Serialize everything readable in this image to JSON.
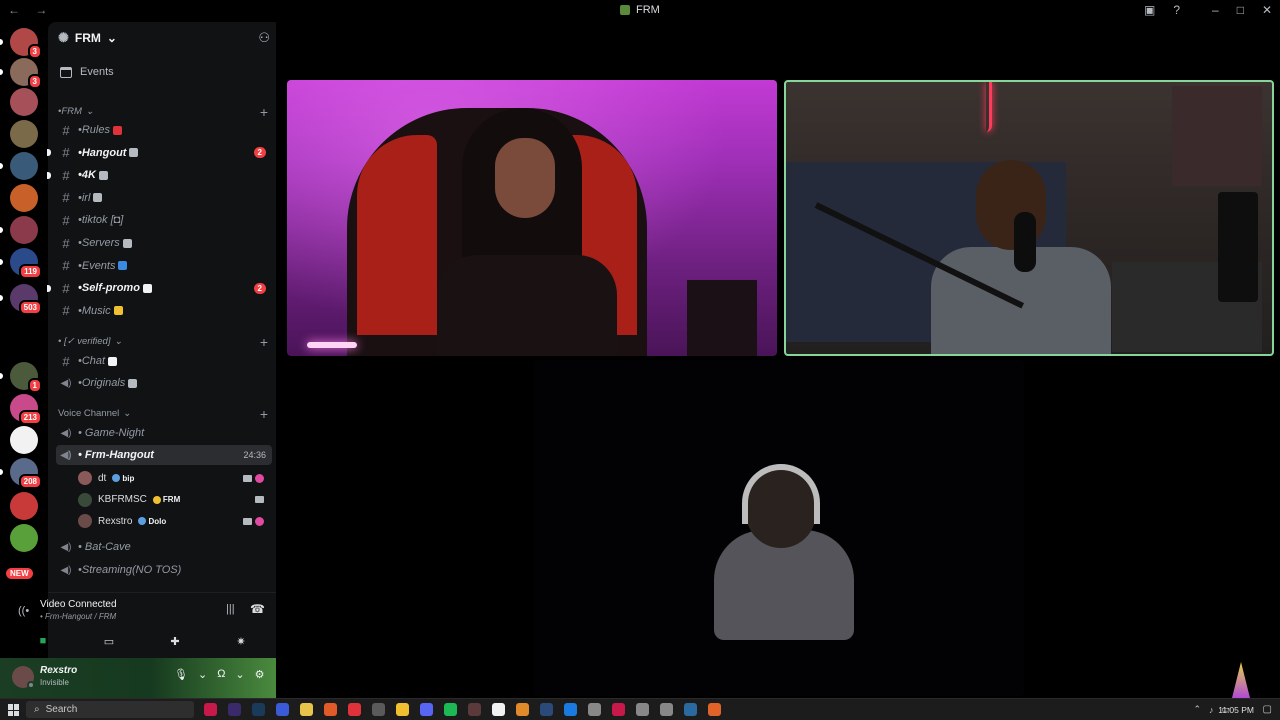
{
  "titlebar": {
    "nav": "← →",
    "title": "FRM",
    "icons": [
      "inbox-icon",
      "help-icon",
      "minimize-icon",
      "maximize-icon",
      "close-icon"
    ]
  },
  "server_rail": {
    "servers": [
      {
        "color": "#b04848",
        "badge": "3",
        "pill": true
      },
      {
        "color": "#8a6a5a",
        "badge": "3",
        "pill": true
      },
      {
        "color": "#a6505a",
        "badge": "",
        "pill": false
      },
      {
        "color": "#7a6a4a",
        "badge": "",
        "pill": false
      },
      {
        "color": "#3a5a7a",
        "badge": "",
        "pill": true
      },
      {
        "color": "#c8602a",
        "badge": "",
        "pill": false
      },
      {
        "color": "#8a3a4a",
        "badge": "",
        "pill": true
      },
      {
        "color": "#2a4a8a",
        "badge": "119",
        "pill": true
      },
      {
        "color": "#5a3a6a",
        "badge": "503",
        "pill": true
      },
      {
        "color": "#4a5a3a",
        "badge": "1",
        "pill": true
      },
      {
        "color": "#c84a8a",
        "badge": "213",
        "pill": false
      },
      {
        "color": "#f2f2f2",
        "badge": "",
        "pill": false
      },
      {
        "color": "#5a6a8a",
        "badge": "208",
        "pill": true
      },
      {
        "color": "#c83a3a",
        "badge": "",
        "pill": false
      },
      {
        "color": "#5aa03a",
        "badge": "",
        "pill": false
      }
    ],
    "new_label": "NEW"
  },
  "sidebar": {
    "guild_name": "FRM",
    "events_label": "Events",
    "categories": [
      {
        "label": "•FRM",
        "style": "italic"
      },
      {
        "label": "• [✓ verified]",
        "style": "italic"
      },
      {
        "label": "Voice Channel",
        "style": "plain"
      }
    ],
    "text_channels": [
      {
        "name": "•Rules",
        "emoji_color": "#e0323a",
        "unread": false,
        "mention": ""
      },
      {
        "name": "•Hangout",
        "emoji_color": "#b5bac1",
        "unread": true,
        "mention": "2"
      },
      {
        "name": "•4K",
        "emoji_color": "#b5bac1",
        "unread": true,
        "mention": ""
      },
      {
        "name": "•irl",
        "emoji_color": "#b5bac1",
        "unread": false,
        "mention": ""
      },
      {
        "name": "•tiktok [◘]",
        "emoji_color": "",
        "unread": false,
        "mention": ""
      },
      {
        "name": "•Servers",
        "emoji_color": "#b5bac1",
        "unread": false,
        "mention": ""
      },
      {
        "name": "•Events",
        "emoji_color": "#3a8ae0",
        "unread": false,
        "mention": ""
      },
      {
        "name": "•Self-promo",
        "emoji_color": "#f2f3f5",
        "unread": true,
        "mention": "2"
      },
      {
        "name": "•Music",
        "emoji_color": "#f0c030",
        "unread": false,
        "mention": ""
      }
    ],
    "verified_channels": [
      {
        "name": "•Chat",
        "type": "text",
        "emoji_color": "#f2f3f5"
      },
      {
        "name": "•Originals",
        "type": "voice",
        "emoji_color": "#b5bac1"
      }
    ],
    "voice_channels": [
      {
        "name": "• Game-Night",
        "active": false,
        "timer": ""
      },
      {
        "name": "• Frm-Hangout",
        "active": true,
        "timer": "24:36"
      },
      {
        "name": "• Bat-Cave",
        "active": false,
        "timer": ""
      },
      {
        "name": "•Streaming(NO TOS)",
        "active": false,
        "timer": ""
      }
    ],
    "voice_members": [
      {
        "name": "dt",
        "tag": "bip",
        "avatar_color": "#8a5a5a",
        "tag_color": "#5aa0e0",
        "video": true,
        "live": true
      },
      {
        "name": "KBFRMSC",
        "tag": "FRM",
        "avatar_color": "#3a4a3a",
        "tag_color": "#f0c030",
        "video": true,
        "live": false
      },
      {
        "name": "Rexstro",
        "tag": "Dolo",
        "avatar_color": "#6b4a4a",
        "tag_color": "#5aa0e0",
        "video": true,
        "live": true
      }
    ]
  },
  "voice_panel": {
    "title": "Video Connected",
    "subtitle": "• Frm-Hangout / FRM"
  },
  "user_panel": {
    "name": "Rexstro",
    "status": "Invisible"
  },
  "stage": {
    "tiles": [
      "participant-1",
      "participant-2",
      "participant-3"
    ]
  },
  "taskbar": {
    "search_placeholder": "Search",
    "apps": [
      "#c81a4a",
      "#3a2a6a",
      "#1a3a5a",
      "#3a5ad8",
      "#e8c44a",
      "#e05a2a",
      "#e0323a",
      "#5a5a5a",
      "#f0c030",
      "#5865f2",
      "#1db954",
      "#5a3a3a",
      "#f2f2f2",
      "#e08a2a",
      "#2a4a7a",
      "#1a7ae0",
      "#888888",
      "#c81a4a",
      "#888888",
      "#888888",
      "#2a6aa0",
      "#e0642a"
    ],
    "time": "11:05 PM"
  }
}
